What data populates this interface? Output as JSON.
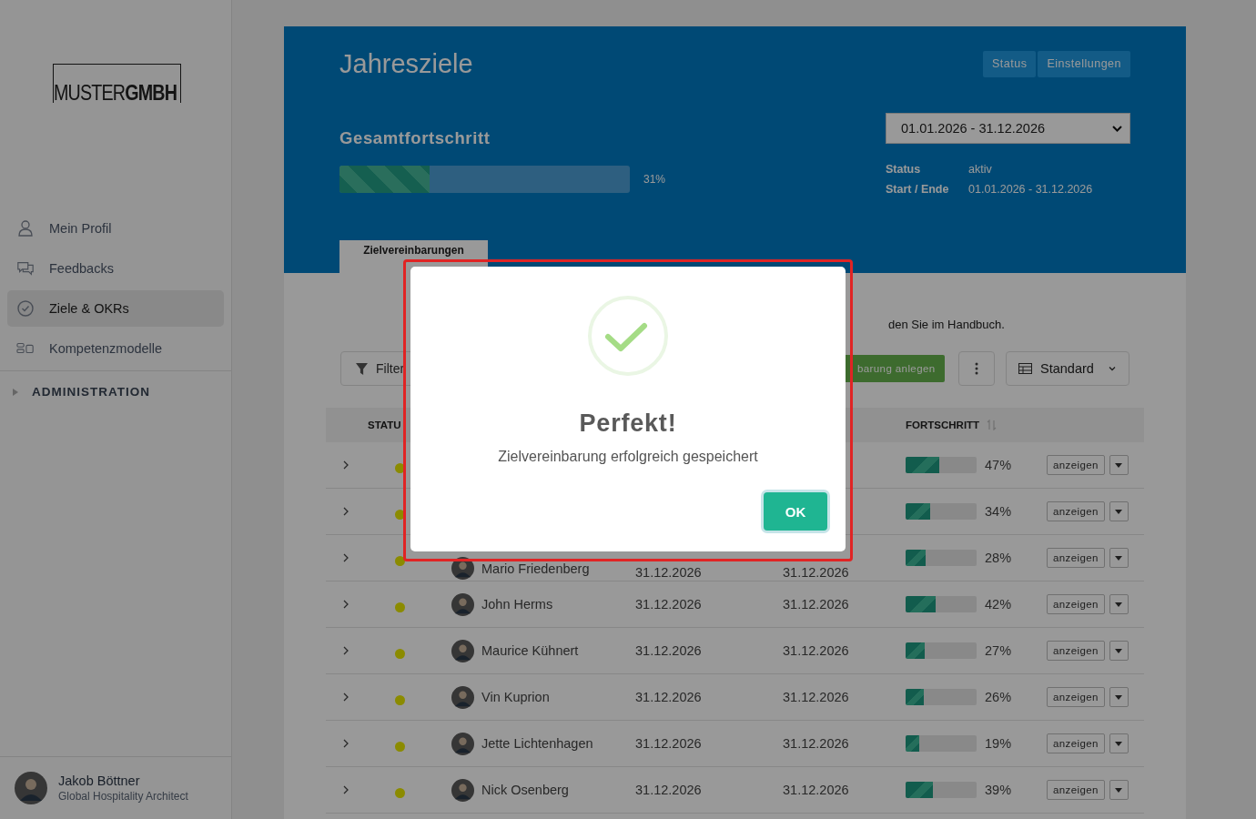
{
  "sidebar": {
    "logo": {
      "light": "MUSTER",
      "bold": "GMBH"
    },
    "items": [
      {
        "label": "Mein Profil",
        "selected": false
      },
      {
        "label": "Feedbacks",
        "selected": false
      },
      {
        "label": "Ziele & OKRs",
        "selected": true
      },
      {
        "label": "Kompetenzmodelle",
        "selected": false
      }
    ],
    "section": {
      "label": "ADMINISTRATION",
      "expanded": false
    },
    "user": {
      "name": "Jakob Böttner",
      "role": "Global Hospitality Architect"
    }
  },
  "header": {
    "title": "Jahresziele",
    "buttons": [
      "Status",
      "Einstellungen"
    ],
    "progress": {
      "title": "Gesamtfortschritt",
      "level": 0.31,
      "reading": "31%"
    },
    "period": {
      "value": "01.01.2026 - 31.12.2026"
    },
    "info": [
      {
        "label": "Status",
        "value": "aktiv"
      },
      {
        "label": "Start / Ende",
        "value": "01.01.2026 - 31.12.2026"
      }
    ],
    "tabs": [
      {
        "label": "Zielvereinbarungen",
        "selected": true
      }
    ]
  },
  "hint": "den Sie im Handbuch.",
  "toolbar": {
    "filter": "Filter",
    "create": "barung anlegen",
    "view": "Standard"
  },
  "table": {
    "columns": {
      "status": "STATU",
      "progress": "FORTSCHRITT"
    },
    "rows": [
      {
        "level": 0.47,
        "percent": "47%",
        "action": "anzeigen"
      },
      {
        "level": 0.34,
        "percent": "34%",
        "action": "anzeigen"
      },
      {
        "name": "Mario Friedenberg",
        "start": "31.12.2026",
        "end": "31.12.2026",
        "level": 0.28,
        "percent": "28%",
        "action": "anzeigen"
      },
      {
        "name": "John Herms",
        "start": "31.12.2026",
        "end": "31.12.2026",
        "level": 0.42,
        "percent": "42%",
        "action": "anzeigen"
      },
      {
        "name": "Maurice Kühnert",
        "start": "31.12.2026",
        "end": "31.12.2026",
        "level": 0.27,
        "percent": "27%",
        "action": "anzeigen"
      },
      {
        "name": "Vin Kuprion",
        "start": "31.12.2026",
        "end": "31.12.2026",
        "level": 0.26,
        "percent": "26%",
        "action": "anzeigen"
      },
      {
        "name": "Jette Lichtenhagen",
        "start": "31.12.2026",
        "end": "31.12.2026",
        "level": 0.19,
        "percent": "19%",
        "action": "anzeigen"
      },
      {
        "name": "Nick Osenberg",
        "start": "31.12.2026",
        "end": "31.12.2026",
        "level": 0.39,
        "percent": "39%",
        "action": "anzeigen"
      }
    ]
  },
  "dialog": {
    "title": "Perfekt!",
    "message": "Zielvereinbarung erfolgreich gespeichert",
    "button": "OK"
  }
}
